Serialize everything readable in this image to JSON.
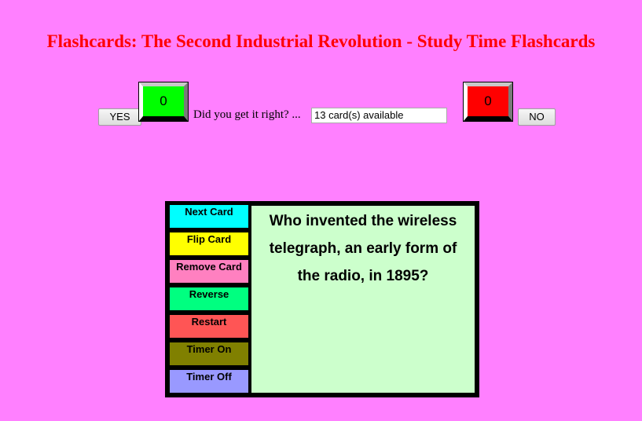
{
  "page": {
    "title": "Flashcards: The Second Industrial Revolution - Study Time Flashcards"
  },
  "scoreboard": {
    "yes_label": "YES",
    "no_label": "NO",
    "correct_count": "0",
    "incorrect_count": "0",
    "prompt": "Did you get it right? ...",
    "status_value": "13 card(s) available",
    "colors": {
      "correct": "#00ff00",
      "incorrect": "#ff0000"
    }
  },
  "controls": [
    {
      "label": "Next Card",
      "color": "#00ffff"
    },
    {
      "label": "Flip Card",
      "color": "#ffff00"
    },
    {
      "label": "Remove Card",
      "color": "#ff80c0"
    },
    {
      "label": "Reverse",
      "color": "#00ff80"
    },
    {
      "label": "Restart",
      "color": "#ff5555"
    },
    {
      "label": "Timer On",
      "color": "#808000"
    },
    {
      "label": "Timer Off",
      "color": "#9999ff"
    }
  ],
  "card": {
    "text": "Who invented the wireless telegraph, an early form of the radio, in 1895?",
    "background": "#ccffcc"
  }
}
